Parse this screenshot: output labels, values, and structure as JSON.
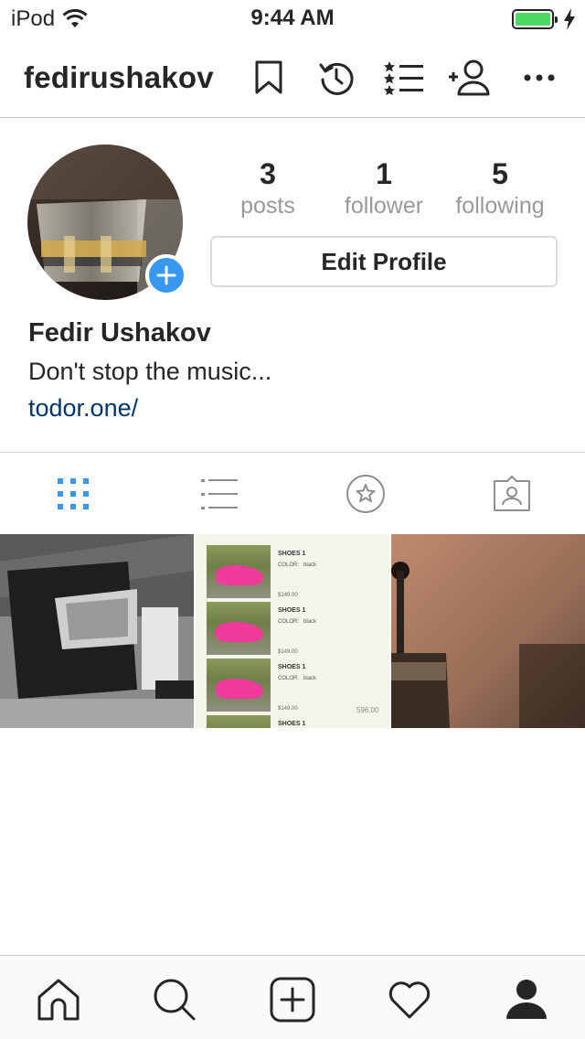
{
  "status": {
    "carrier": "iPod",
    "time": "9:44 AM",
    "battery_percent": 100
  },
  "header": {
    "username": "fedirushakov"
  },
  "profile": {
    "stats": [
      {
        "number": "3",
        "label": "posts"
      },
      {
        "number": "1",
        "label": "follower"
      },
      {
        "number": "5",
        "label": "following"
      }
    ],
    "edit_label": "Edit Profile",
    "full_name": "Fedir Ushakov",
    "bio": "Don't stop the music...",
    "website": "todor.one/"
  },
  "shoes": {
    "items": [
      {
        "title": "SHOES 1",
        "color_label": "COLOR:",
        "color_value": "black",
        "price": "$149.00"
      },
      {
        "title": "SHOES 1",
        "color_label": "COLOR:",
        "color_value": "black",
        "price": "$149.00"
      },
      {
        "title": "SHOES 1",
        "color_label": "COLOR:",
        "color_value": "black",
        "price": "$149.00"
      },
      {
        "title": "SHOES 1"
      }
    ],
    "total": "596.00"
  },
  "colors": {
    "accent": "#3897f0",
    "link": "#003569",
    "muted": "#999999",
    "battery": "#4cd964"
  },
  "icons": {
    "header": [
      "bookmark-icon",
      "history-icon",
      "close-friends-list-icon",
      "add-person-icon",
      "more-icon"
    ],
    "tabs": [
      "grid-icon",
      "list-icon",
      "saved-star-icon",
      "tagged-icon"
    ],
    "nav": [
      "home-icon",
      "search-icon",
      "add-post-icon",
      "heart-icon",
      "profile-icon"
    ]
  }
}
